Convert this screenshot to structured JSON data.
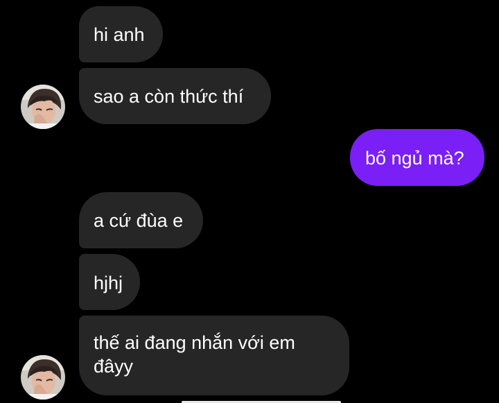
{
  "conversation": {
    "messages": [
      {
        "direction": "incoming",
        "text": "hi anh"
      },
      {
        "direction": "incoming",
        "text": "sao a còn thức thí"
      },
      {
        "direction": "outgoing",
        "text": "bố ngủ mà?"
      },
      {
        "direction": "incoming",
        "text": "a cứ đùa e"
      },
      {
        "direction": "incoming",
        "text": "hjhj"
      },
      {
        "direction": "incoming",
        "text": "thế ai đang nhắn với em đâyy"
      }
    ]
  },
  "colors": {
    "background": "#000000",
    "incoming_bubble": "#262626",
    "outgoing_bubble": "#7a1ff5",
    "text": "#ffffff"
  },
  "icons": {
    "sender_avatar": "sender-avatar-photo"
  }
}
